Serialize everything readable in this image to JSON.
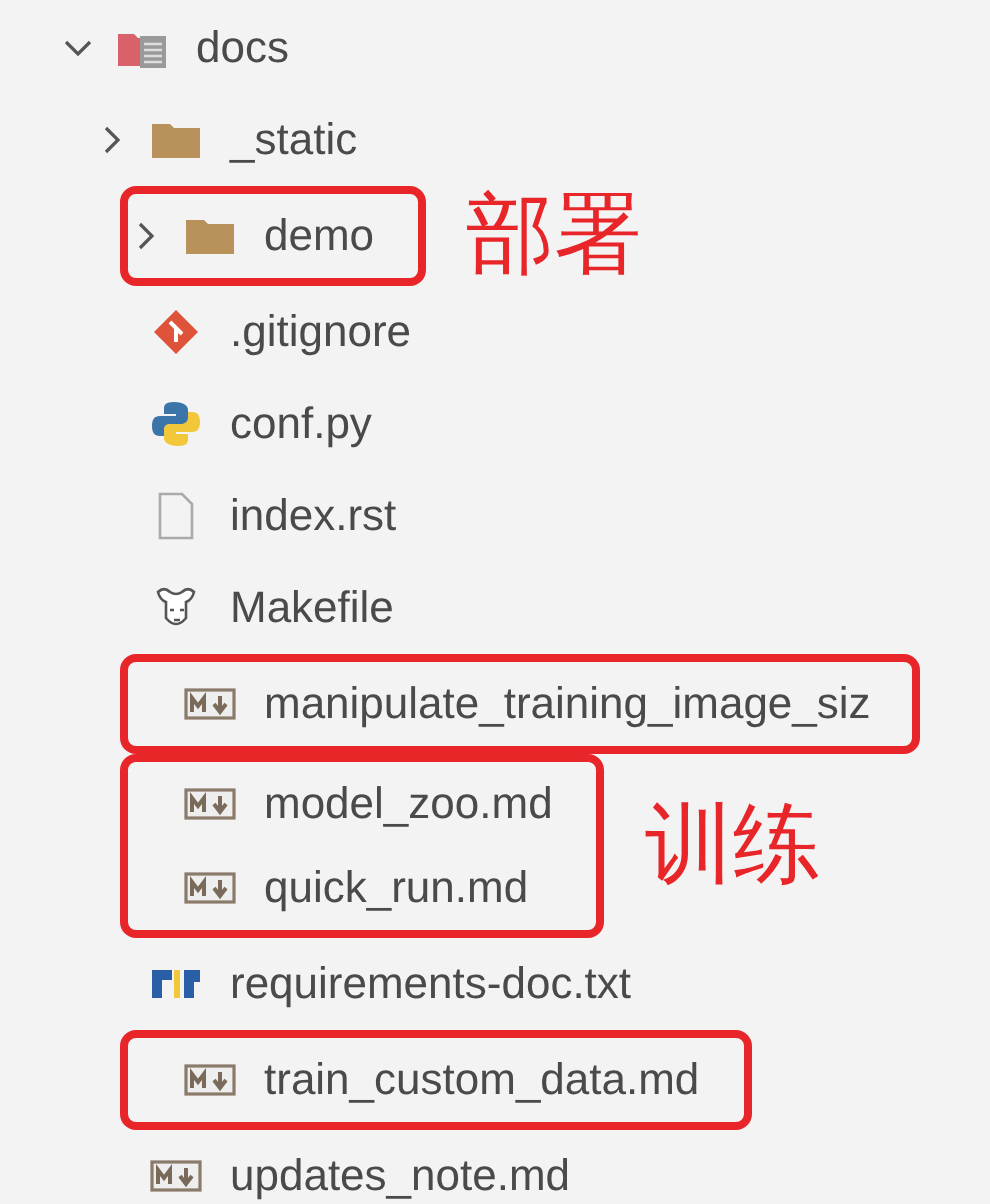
{
  "tree": {
    "name": "docs",
    "kind": "docs-folder",
    "expanded": true,
    "children": [
      {
        "name": "_static",
        "kind": "folder",
        "expanded": false
      },
      {
        "kind": "annotation",
        "label": "部署",
        "children": [
          {
            "name": "demo",
            "kind": "folder",
            "expanded": false
          }
        ]
      },
      {
        "name": ".gitignore",
        "kind": "git"
      },
      {
        "name": "conf.py",
        "kind": "python"
      },
      {
        "name": "index.rst",
        "kind": "file"
      },
      {
        "name": "Makefile",
        "kind": "makefile"
      },
      {
        "kind": "annotation",
        "children": [
          {
            "name": "manipulate_training_image_siz",
            "kind": "markdown"
          }
        ]
      },
      {
        "kind": "annotation",
        "label": "训练",
        "children": [
          {
            "name": "model_zoo.md",
            "kind": "markdown"
          },
          {
            "name": "quick_run.md",
            "kind": "markdown"
          }
        ]
      },
      {
        "name": "requirements-doc.txt",
        "kind": "pip"
      },
      {
        "kind": "annotation",
        "children": [
          {
            "name": "train_custom_data.md",
            "kind": "markdown"
          }
        ]
      },
      {
        "name": "updates_note.md",
        "kind": "markdown"
      }
    ]
  }
}
